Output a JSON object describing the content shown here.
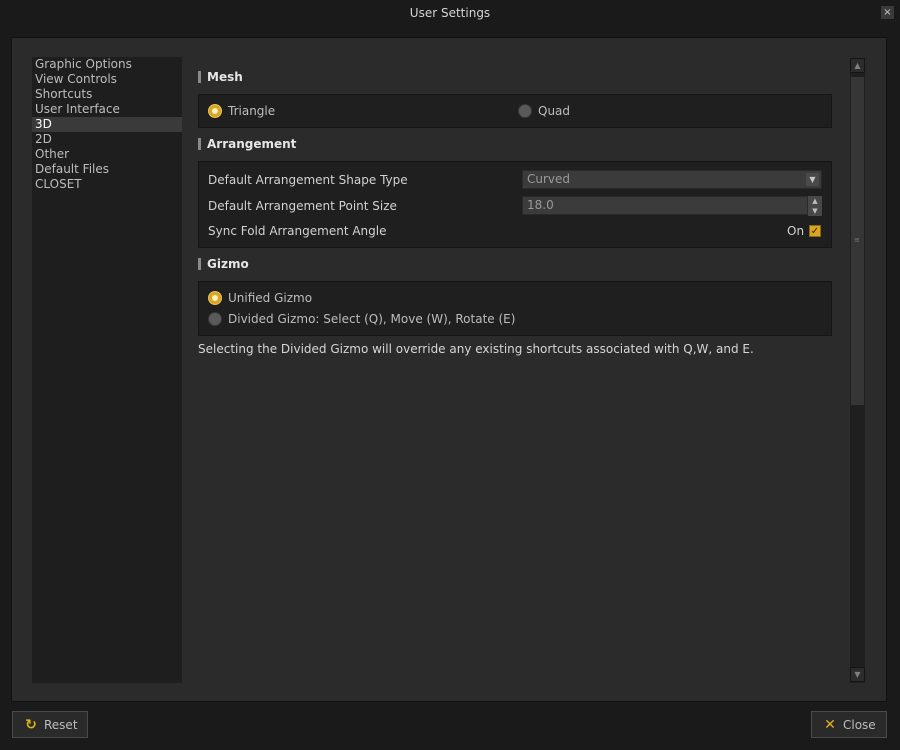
{
  "window": {
    "title": "User Settings",
    "close_glyph": "×"
  },
  "sidebar": {
    "items": [
      {
        "label": "Graphic Options"
      },
      {
        "label": "View Controls"
      },
      {
        "label": "Shortcuts"
      },
      {
        "label": "User Interface"
      },
      {
        "label": "3D",
        "active": true
      },
      {
        "label": "2D"
      },
      {
        "label": "Other"
      },
      {
        "label": "Default Files"
      },
      {
        "label": "CLOSET"
      }
    ]
  },
  "mesh": {
    "heading": "Mesh",
    "options": [
      {
        "label": "Triangle",
        "selected": true
      },
      {
        "label": "Quad",
        "selected": false
      }
    ]
  },
  "arrangement": {
    "heading": "Arrangement",
    "shape_type": {
      "label": "Default Arrangement Shape Type",
      "value": "Curved"
    },
    "point_size": {
      "label": "Default Arrangement Point Size",
      "value": "18.0"
    },
    "sync_fold": {
      "label": "Sync Fold Arrangement Angle",
      "state_text": "On",
      "checked": true
    }
  },
  "gizmo": {
    "heading": "Gizmo",
    "options": [
      {
        "label": "Unified Gizmo",
        "selected": true
      },
      {
        "label": "Divided Gizmo: Select (Q), Move (W), Rotate (E)",
        "selected": false
      }
    ],
    "note": "Selecting the Divided Gizmo will override any existing shortcuts associated with Q,W, and E."
  },
  "footer": {
    "reset_label": "Reset",
    "close_label": "Close"
  },
  "colors": {
    "accent": "#d9a621",
    "panel": "#2b2b2b",
    "group": "#1f1f1f",
    "close_icon": "#e0b21a",
    "reset_icon": "#e0b21a"
  },
  "icons": {
    "reset": "refresh-icon",
    "close": "close-icon",
    "dropdown": "chevron-down-icon"
  }
}
